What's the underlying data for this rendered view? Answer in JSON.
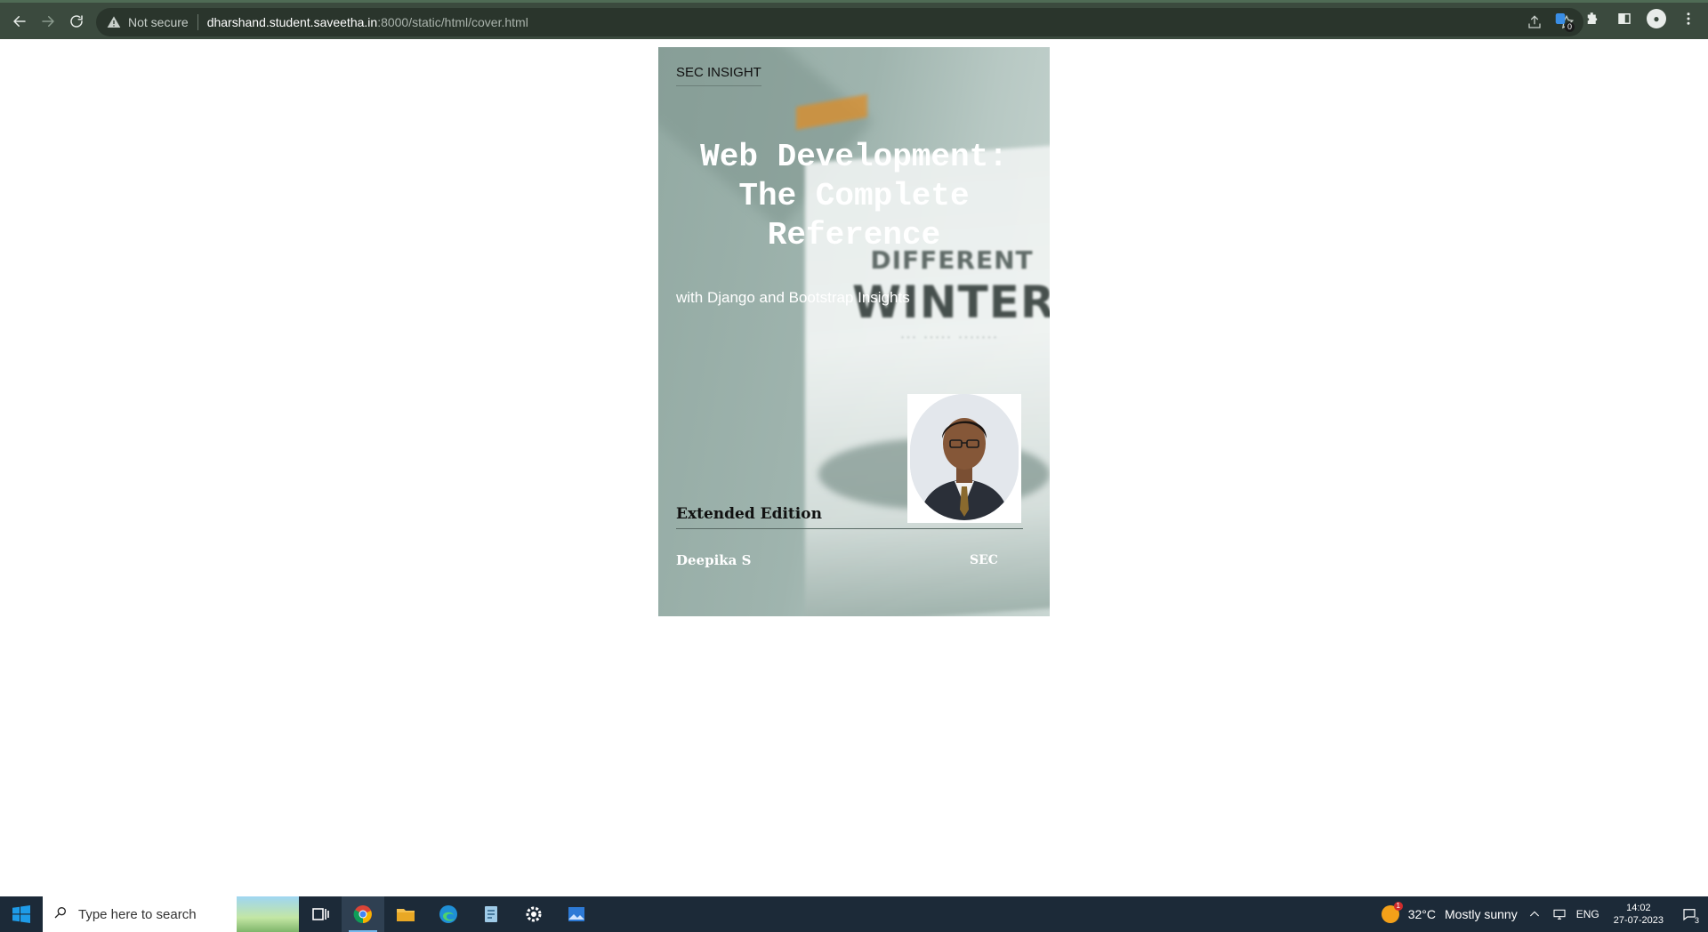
{
  "browser": {
    "security_label": "Not secure",
    "url_host": "dharshand.student.saveetha.in",
    "url_path": ":8000/static/html/cover.html",
    "extension_count": "0"
  },
  "cover": {
    "brand": "SEC INSIGHT",
    "title": "Web Development: The Complete Reference",
    "subtitle": "with Django and Bootstrap Insights",
    "background_book_title_line1": "DIFFERENT",
    "background_book_title_line2": "WINTER",
    "edition": "Extended Edition",
    "author": "Deepika S",
    "publisher": "SEC"
  },
  "taskbar": {
    "search_placeholder": "Type here to search",
    "apps": [
      "start-menu",
      "search",
      "task-view",
      "chrome",
      "file-explorer",
      "edge",
      "notepad",
      "settings",
      "photos"
    ],
    "weather_temp": "32°C",
    "weather_text": "Mostly sunny",
    "weather_alert_count": "1",
    "language": "ENG",
    "time": "14:02",
    "date": "27-07-2023",
    "notification_count": "3"
  },
  "colors": {
    "chrome_bg": "#3b4a3e",
    "cover_bg": "#9fb4ae",
    "taskbar_bg": "#1c2a38"
  }
}
